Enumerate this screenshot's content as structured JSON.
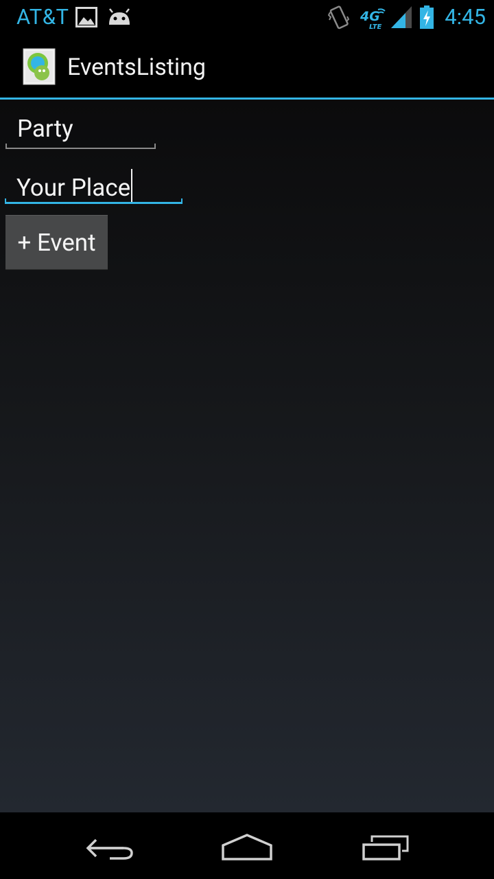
{
  "status_bar": {
    "carrier": "AT&T",
    "time": "4:45",
    "accent_color": "#33b5e5",
    "icons": [
      "image-notification-icon",
      "android-debug-icon",
      "vibrate-icon",
      "4g-lte-icon",
      "signal-icon",
      "battery-charging-icon"
    ]
  },
  "action_bar": {
    "title": "EventsListing",
    "icon": "app-launcher-icon"
  },
  "form": {
    "title_value": "Party",
    "place_value": "Your Place",
    "add_button_label": "+ Event"
  },
  "nav_bar": {
    "buttons": [
      "back-icon",
      "home-icon",
      "recent-apps-icon"
    ]
  }
}
